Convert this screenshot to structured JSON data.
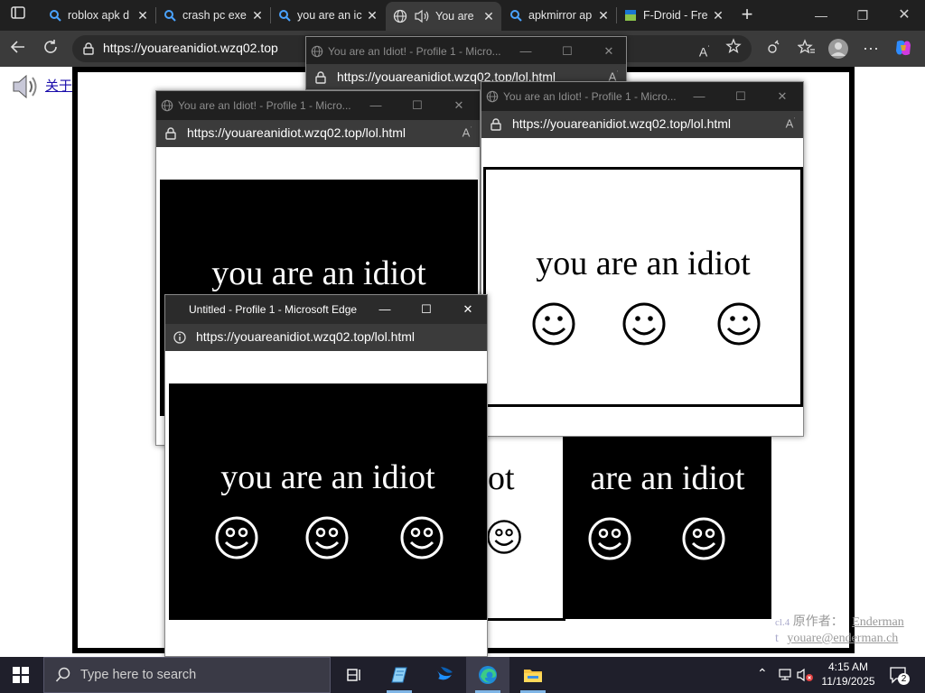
{
  "browser": {
    "tabs": [
      {
        "label": "roblox apk d",
        "icon": "search-icon",
        "active": false
      },
      {
        "label": "crash pc exe",
        "icon": "search-icon",
        "active": false
      },
      {
        "label": "you are an ic",
        "icon": "search-icon",
        "active": false
      },
      {
        "label": "You are",
        "icon": "globe-icon",
        "audio": true,
        "active": true
      },
      {
        "label": "apkmirror ap",
        "icon": "search-icon",
        "active": false
      },
      {
        "label": "F-Droid - Fre",
        "icon": "fdroid-icon",
        "active": false
      }
    ],
    "address": "https://youareanidiot.wzq02.top",
    "colors": {
      "chrome_dark": "#202020",
      "toolbar": "#3b3b3b",
      "link": "#1a0dab"
    }
  },
  "page": {
    "top_link": "关于",
    "footer_line1_prefix": "原作者：",
    "footer_line1_link": "Enderman",
    "footer_line2_link": "youare@enderman.ch",
    "footer_frag1": "cl.4",
    "footer_frag2": "t"
  },
  "popups": {
    "back_top": {
      "title": "You are an Idiot! - Profile 1 - Micro...",
      "url": "https://youareanidiot.wzq02.top/lol.html"
    },
    "left": {
      "title": "You are an Idiot! - Profile 1 - Micro...",
      "url": "https://youareanidiot.wzq02.top/lol.html",
      "phrase": "you are an idiot"
    },
    "right": {
      "title": "You are an Idiot! - Profile 1 - Micro...",
      "url": "https://youareanidiot.wzq02.top/lol.html",
      "phrase": "you are an idiot"
    },
    "front": {
      "title": "Untitled - Profile 1 - Microsoft Edge",
      "url": "https://youareanidiot.wzq02.top/lol.html",
      "phrase": "you are an idiot"
    },
    "behind_mid": {
      "phrase": "ot"
    },
    "behind_right": {
      "phrase": "are an idiot"
    }
  },
  "taskbar": {
    "search_placeholder": "Type here to search",
    "time": "4:15 AM",
    "date": "11/19/2025",
    "notification_count": "2"
  }
}
